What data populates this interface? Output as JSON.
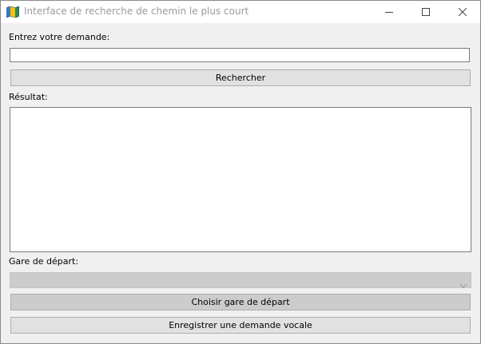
{
  "window": {
    "title": "Interface de recherche de chemin le plus court",
    "icon": "map-icon",
    "controls": [
      "minimize-icon",
      "maximize-icon",
      "close-icon"
    ]
  },
  "query": {
    "label": "Entrez votre demande:",
    "value": "",
    "placeholder": ""
  },
  "search_button": {
    "label": "Rechercher"
  },
  "result": {
    "label": "Résultat:",
    "content": ""
  },
  "departure": {
    "label": "Gare de départ:",
    "selected": ""
  },
  "choose_button": {
    "label": "Choisir gare de départ"
  },
  "voice_button": {
    "label": "Enregistrer une demande vocale"
  }
}
